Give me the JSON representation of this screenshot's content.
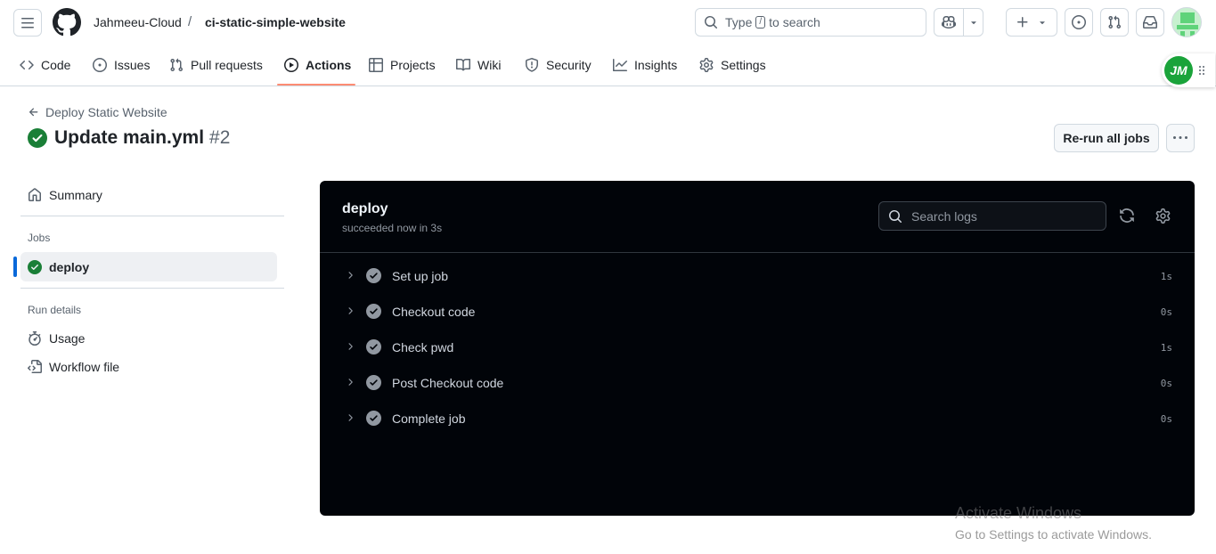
{
  "header": {
    "owner": "Jahmeeu-Cloud",
    "separator": "/",
    "repo": "ci-static-simple-website",
    "search_prefix": "Type",
    "search_key": "/",
    "search_suffix": "to search"
  },
  "repo_nav": {
    "items": [
      {
        "label": "Code",
        "icon": "code-icon"
      },
      {
        "label": "Issues",
        "icon": "issue-opened-icon"
      },
      {
        "label": "Pull requests",
        "icon": "git-pull-request-icon"
      },
      {
        "label": "Actions",
        "icon": "play-icon",
        "active": true
      },
      {
        "label": "Projects",
        "icon": "table-icon"
      },
      {
        "label": "Wiki",
        "icon": "book-icon"
      },
      {
        "label": "Security",
        "icon": "shield-icon"
      },
      {
        "label": "Insights",
        "icon": "graph-icon"
      },
      {
        "label": "Settings",
        "icon": "gear-icon"
      }
    ],
    "active_color": "#fd8c73"
  },
  "floating_badge": {
    "initials": "JM",
    "color": "#1aa33a"
  },
  "run": {
    "back_label": "Deploy Static Website",
    "title": "Update main.yml",
    "number": "#2",
    "status": "success",
    "status_color": "#1a7f37",
    "rerun_label": "Re-run all jobs"
  },
  "sidebar": {
    "summary_label": "Summary",
    "jobs_heading": "Jobs",
    "jobs": [
      {
        "label": "deploy",
        "status": "success"
      }
    ],
    "run_details_heading": "Run details",
    "usage_label": "Usage",
    "workflow_file_label": "Workflow file",
    "accent": "#0969da"
  },
  "log": {
    "job_name": "deploy",
    "job_status": "succeeded now in 3s",
    "search_placeholder": "Search logs",
    "steps": [
      {
        "label": "Set up job",
        "duration": "1s"
      },
      {
        "label": "Checkout code",
        "duration": "0s"
      },
      {
        "label": "Check pwd",
        "duration": "1s"
      },
      {
        "label": "Post Checkout code",
        "duration": "0s"
      },
      {
        "label": "Complete job",
        "duration": "0s"
      }
    ]
  },
  "watermark": {
    "title": "Activate Windows",
    "subtitle": "Go to Settings to activate Windows."
  }
}
